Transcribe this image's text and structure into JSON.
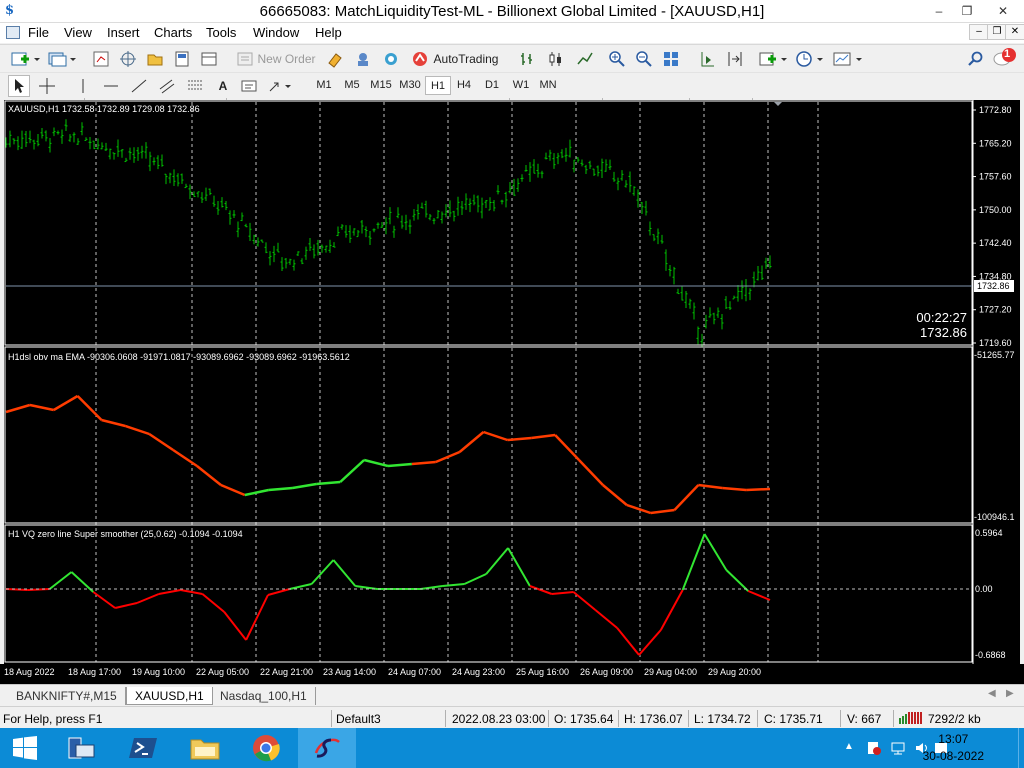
{
  "window": {
    "title": "66665083: MatchLiquidityTest-ML - Billionext Global Limited - [XAUUSD,H1]"
  },
  "menu": [
    "File",
    "View",
    "Insert",
    "Charts",
    "Tools",
    "Window",
    "Help"
  ],
  "toolbar": {
    "new_order": "New Order",
    "autotrading": "AutoTrading"
  },
  "timeframes": [
    "M1",
    "M5",
    "M15",
    "M30",
    "H1",
    "H4",
    "D1",
    "W1",
    "MN"
  ],
  "active_timeframe": "H1",
  "notification_count": "1",
  "chart": {
    "header": "XAUUSD,H1  1732.58 1732.89 1729.08 1732.86",
    "countdown": "00:22:27",
    "bid": "1732.86",
    "price_ticks": [
      "1772.80",
      "1765.20",
      "1757.60",
      "1750.00",
      "1742.40",
      "1734.80",
      "1727.20",
      "1719.60"
    ],
    "price_label": "1732.86",
    "ind1_header": "H1dsl  obv ma  EMA  -90306.0608 -91971.0817 -93089.6962 -93089.6962 -91963.5612",
    "ind1_ticks": [
      "-51265.77",
      "-100946.1"
    ],
    "ind2_header": "H1 VQ zero line Super smoother (25,0.62) -0.1094 -0.1094",
    "ind2_ticks": [
      "0.5964",
      "0.00",
      "-0.6868"
    ],
    "time_labels": [
      "18 Aug 2022",
      "18 Aug 17:00",
      "19 Aug 10:00",
      "22 Aug 05:00",
      "22 Aug 21:00",
      "23 Aug 14:00",
      "24 Aug 07:00",
      "24 Aug 23:00",
      "25 Aug 16:00",
      "26 Aug 09:00",
      "29 Aug 04:00",
      "29 Aug 20:00"
    ],
    "colors": {
      "candle": "#00c000",
      "bear_line": "#ff3c00",
      "bull_line": "#32e632",
      "grid": "#c0c0c0",
      "osc_neg": "#ff0000"
    }
  },
  "chart_data": {
    "type": "line",
    "title": "XAUUSD,H1",
    "xlabel": "",
    "ylabel": "",
    "ylim": [
      1719.6,
      1772.8
    ],
    "x": [
      "18 Aug 2022",
      "18 Aug 17:00",
      "19 Aug 10:00",
      "22 Aug 05:00",
      "22 Aug 21:00",
      "23 Aug 14:00",
      "24 Aug 07:00",
      "24 Aug 23:00",
      "25 Aug 16:00",
      "26 Aug 09:00",
      "29 Aug 04:00",
      "29 Aug 20:00"
    ],
    "series": [
      {
        "values": [
          1766,
          1767,
          1762,
          1752,
          1738,
          1745,
          1749,
          1752,
          1763,
          1756,
          1722,
          1737
        ]
      }
    ]
  },
  "tabs": [
    "BANKNIFTY#,M15",
    "XAUUSD,H1",
    "Nasdaq_100,H1"
  ],
  "active_tab": "XAUUSD,H1",
  "status": {
    "help": "For Help, press F1",
    "profile": "Default3",
    "datetime": "2022.08.23 03:00",
    "open": "O: 1735.64",
    "high": "H: 1736.07",
    "low": "L: 1734.72",
    "close": "C: 1735.71",
    "volume": "V: 667",
    "traffic": "7292/2 kb"
  },
  "taskbar": {
    "time": "13:07",
    "date": "30-08-2022"
  }
}
